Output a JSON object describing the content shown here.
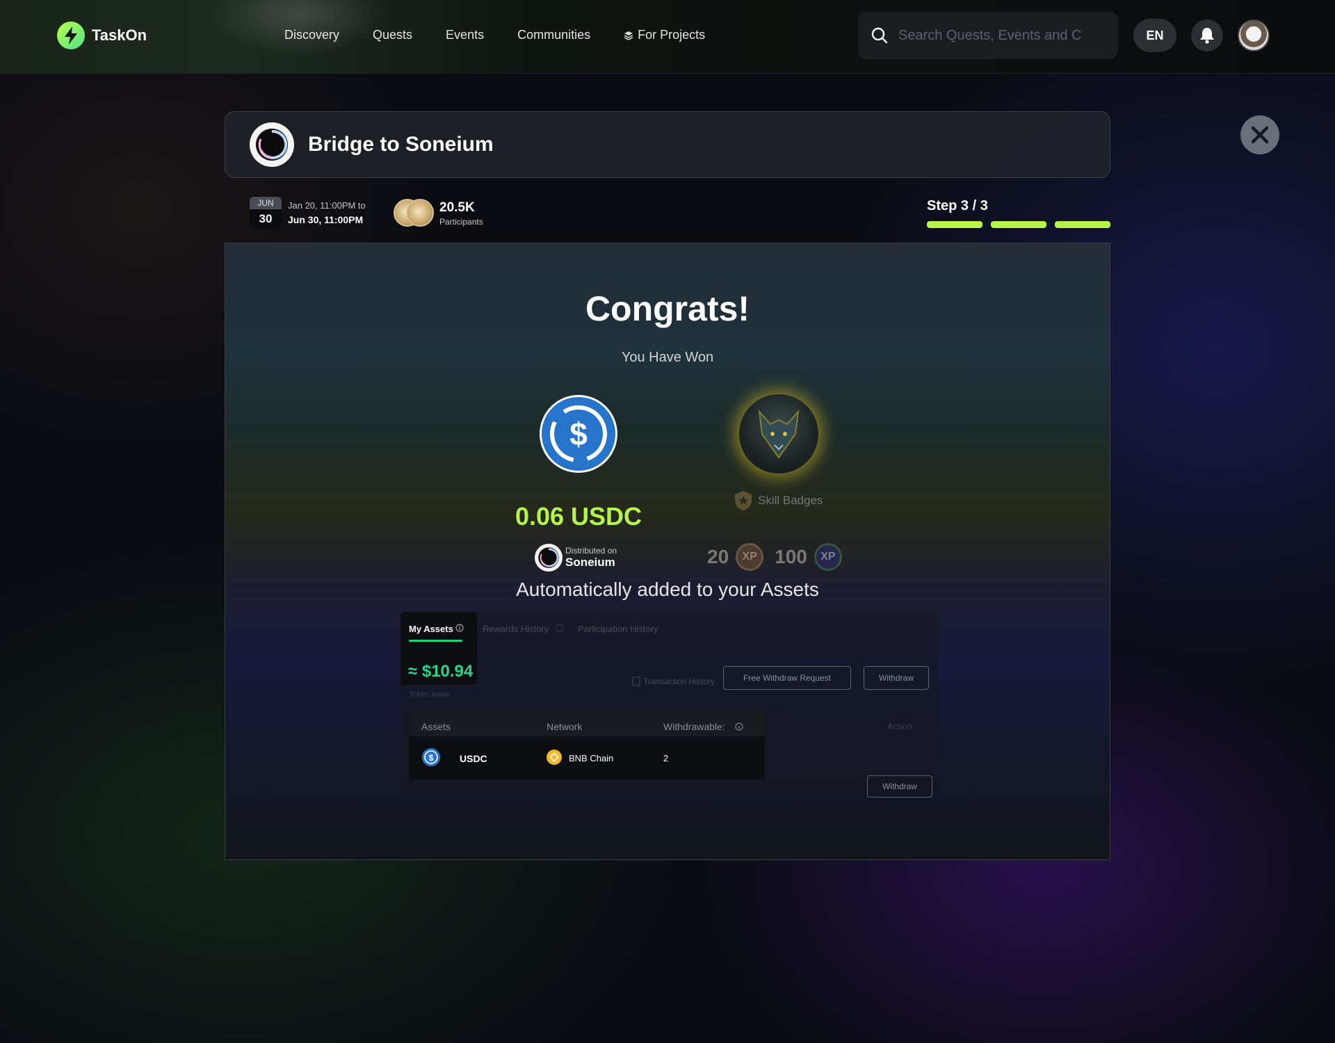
{
  "header": {
    "logo_text": "TaskOn",
    "nav": [
      "Discovery",
      "Quests",
      "Events",
      "Communities",
      "For Projects"
    ],
    "search_placeholder": "Search Quests, Events and Communities",
    "lang": "EN"
  },
  "quest": {
    "title": "Bridge to Soneium",
    "date_month": "JUN",
    "date_day": "30",
    "date_from": "Jan 20, 11:00PM to",
    "date_to": "Jun 30, 11:00PM",
    "participants_count": "20.5K",
    "participants_label": "Participants",
    "step_label": "Step 3 / 3",
    "steps_total": 3,
    "steps_done": 3
  },
  "result": {
    "congrats": "Congrats!",
    "subtitle": "You Have Won",
    "reward_amount": "0.06 USDC",
    "distributed_label": "Distributed on",
    "distributed_network": "Soneium",
    "skill_badges_label": "Skill Badges",
    "xp_a": "20",
    "xp_a_icon": "XP",
    "xp_b": "100",
    "xp_b_icon": "XP",
    "auto_added": "Automatically added to your Assets"
  },
  "assets": {
    "tabs": [
      "My Assets",
      "Rewards History",
      "Participation History"
    ],
    "total": "≈ $10.94",
    "token_asset_label": "Token Asset",
    "tx_history": "Transaction History",
    "free_withdraw": "Free Withdraw Request",
    "withdraw": "Withdraw",
    "columns": [
      "Assets",
      "Network",
      "Withdrawable:",
      "Action"
    ],
    "row": {
      "asset": "USDC",
      "network": "BNB Chain",
      "withdrawable": "2",
      "action": "Withdraw"
    }
  },
  "colors": {
    "accent_green": "#b7f34a",
    "asset_green": "#23d88a",
    "usdc_blue": "#2775ca"
  }
}
